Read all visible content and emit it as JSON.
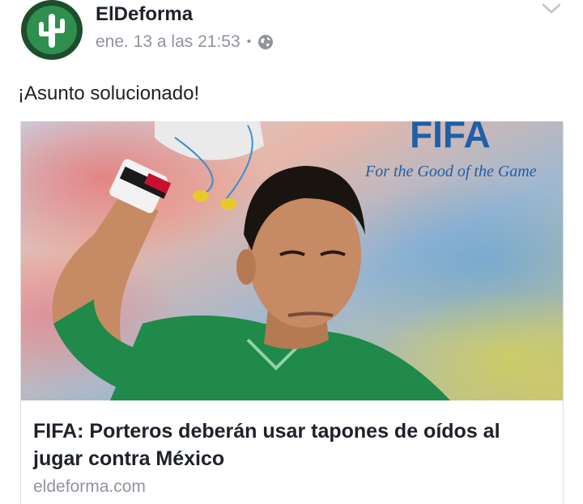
{
  "post": {
    "page_name": "ElDeforma",
    "timestamp": "ene. 13 a las 21:53",
    "separator": "•",
    "audience_icon": "globe-icon",
    "menu_icon": "chevron-down-icon",
    "avatar_icon": "cactus-logo",
    "text": "¡Asunto solucionado!"
  },
  "link_card": {
    "image_brand": "FIFA",
    "image_slogan": "For the Good of the Game",
    "title": "FIFA: Porteros deberán usar tapones de oídos al jugar contra México",
    "domain": "eldeforma.com"
  },
  "colors": {
    "avatar_green": "#2f8f4e",
    "fifa_blue": "#1f5fa8",
    "jersey_green": "#1f8a4a",
    "meta_gray": "#90949c"
  }
}
